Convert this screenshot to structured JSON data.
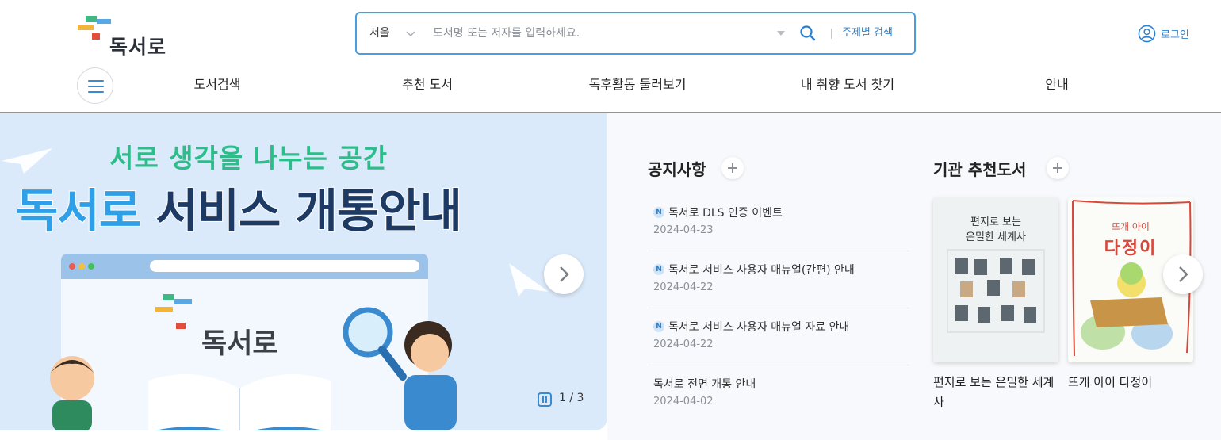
{
  "header": {
    "logo_text": "독서로",
    "search": {
      "region": "서울",
      "placeholder": "도서명 또는 저자를 입력하세요.",
      "topic_search_label": "주제별 검색"
    },
    "login_label": "로그인"
  },
  "nav": {
    "items": [
      {
        "label": "도서검색"
      },
      {
        "label": "추천 도서"
      },
      {
        "label": "독후활동 둘러보기"
      },
      {
        "label": "내 취향 도서 찾기"
      },
      {
        "label": "안내"
      }
    ]
  },
  "banner": {
    "line1": "서로 생각을 나누는 공간",
    "line2_a": "독서로",
    "line2_b": " 서비스 개통안내",
    "brand": "독서로",
    "slide_current": "1",
    "slide_total": "3",
    "slide_counter": "1 / 3"
  },
  "notices": {
    "title": "공지사항",
    "badge": "N",
    "items": [
      {
        "title": "독서로 DLS 인증 이벤트",
        "date": "2024-04-23",
        "new": true
      },
      {
        "title": "독서로 서비스 사용자 매뉴얼(간편) 안내",
        "date": "2024-04-22",
        "new": true
      },
      {
        "title": "독서로 서비스 사용자 매뉴얼 자료 안내",
        "date": "2024-04-22",
        "new": true
      },
      {
        "title": "독서로 전면 개통 안내",
        "date": "2024-04-02",
        "new": false
      }
    ]
  },
  "recommend": {
    "title": "기관 추천도서",
    "books": [
      {
        "caption": "편지로 보는 은밀한 세계사",
        "cover_title": "편지로 보는\n은밀한 세계사"
      },
      {
        "caption": "뜨개 아이 다정이",
        "cover_title_small": "뜨개 아이",
        "cover_title_large": "다정이"
      }
    ]
  },
  "colors": {
    "accent": "#2b7fcc",
    "search_border": "#4a9ee0",
    "banner_bg": "#dbeafa",
    "banner_green": "#2dbd8a",
    "banner_blue": "#2fa0e8",
    "banner_navy": "#1c3a64"
  }
}
